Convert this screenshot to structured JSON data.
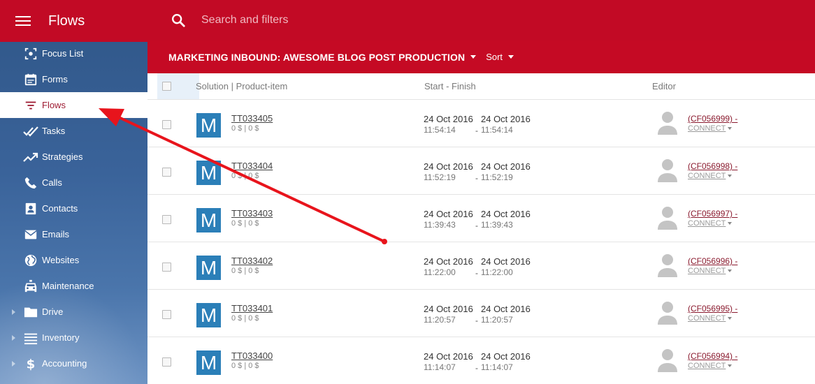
{
  "app": {
    "title": "Flows"
  },
  "search": {
    "placeholder": "Search and filters"
  },
  "toolbar": {
    "flow_title": "MARKETING INBOUND: AWESOME BLOG POST PRODUCTION",
    "sort_label": "Sort"
  },
  "sidebar": {
    "items": [
      {
        "label": "Focus List",
        "icon": "focus-icon",
        "active": false
      },
      {
        "label": "Forms",
        "icon": "calendar-icon",
        "active": false
      },
      {
        "label": "Flows",
        "icon": "filter-icon",
        "active": true
      },
      {
        "label": "Tasks",
        "icon": "double-check-icon",
        "active": false
      },
      {
        "label": "Strategies",
        "icon": "trending-up-icon",
        "active": false
      },
      {
        "label": "Calls",
        "icon": "phone-icon",
        "active": false
      },
      {
        "label": "Contacts",
        "icon": "contact-card-icon",
        "active": false
      },
      {
        "label": "Emails",
        "icon": "envelope-icon",
        "active": false
      },
      {
        "label": "Websites",
        "icon": "globe-icon",
        "active": false
      },
      {
        "label": "Maintenance",
        "icon": "car-icon",
        "active": false
      },
      {
        "label": "Drive",
        "icon": "folder-icon",
        "active": false,
        "expandable": true
      },
      {
        "label": "Inventory",
        "icon": "list-icon",
        "active": false,
        "expandable": true
      },
      {
        "label": "Accounting",
        "icon": "dollar-icon",
        "active": false,
        "expandable": true
      }
    ]
  },
  "table": {
    "headers": {
      "solution": "Solution | Product-item",
      "dates": "Start - Finish",
      "editor": "Editor"
    },
    "rows": [
      {
        "avatar": "M",
        "id": "TT033405",
        "price": "0 $ | 0 $",
        "start_date": "24 Oct 2016",
        "start_time": "11:54:14",
        "finish_date": "24 Oct 2016",
        "finish_time": "11:54:14",
        "editor": "(CF056999) -",
        "connect": "CONNECT"
      },
      {
        "avatar": "M",
        "id": "TT033404",
        "price": "0 $ | 0 $",
        "start_date": "24 Oct 2016",
        "start_time": "11:52:19",
        "finish_date": "24 Oct 2016",
        "finish_time": "11:52:19",
        "editor": "(CF056998) -",
        "connect": "CONNECT"
      },
      {
        "avatar": "M",
        "id": "TT033403",
        "price": "0 $ | 0 $",
        "start_date": "24 Oct 2016",
        "start_time": "11:39:43",
        "finish_date": "24 Oct 2016",
        "finish_time": "11:39:43",
        "editor": "(CF056997) -",
        "connect": "CONNECT"
      },
      {
        "avatar": "M",
        "id": "TT033402",
        "price": "0 $ | 0 $",
        "start_date": "24 Oct 2016",
        "start_time": "11:22:00",
        "finish_date": "24 Oct 2016",
        "finish_time": "11:22:00",
        "editor": "(CF056996) -",
        "connect": "CONNECT"
      },
      {
        "avatar": "M",
        "id": "TT033401",
        "price": "0 $ | 0 $",
        "start_date": "24 Oct 2016",
        "start_time": "11:20:57",
        "finish_date": "24 Oct 2016",
        "finish_time": "11:20:57",
        "editor": "(CF056995) -",
        "connect": "CONNECT"
      },
      {
        "avatar": "M",
        "id": "TT033400",
        "price": "0 $ | 0 $",
        "start_date": "24 Oct 2016",
        "start_time": "11:14:07",
        "finish_date": "24 Oct 2016",
        "finish_time": "11:14:07",
        "editor": "(CF056994) -",
        "connect": "CONNECT"
      }
    ]
  },
  "colors": {
    "brand_red": "#c20a25",
    "sidebar_blue": "#3a639a",
    "avatar_blue": "#2b7fb8",
    "annotation_red": "#e8141c"
  }
}
